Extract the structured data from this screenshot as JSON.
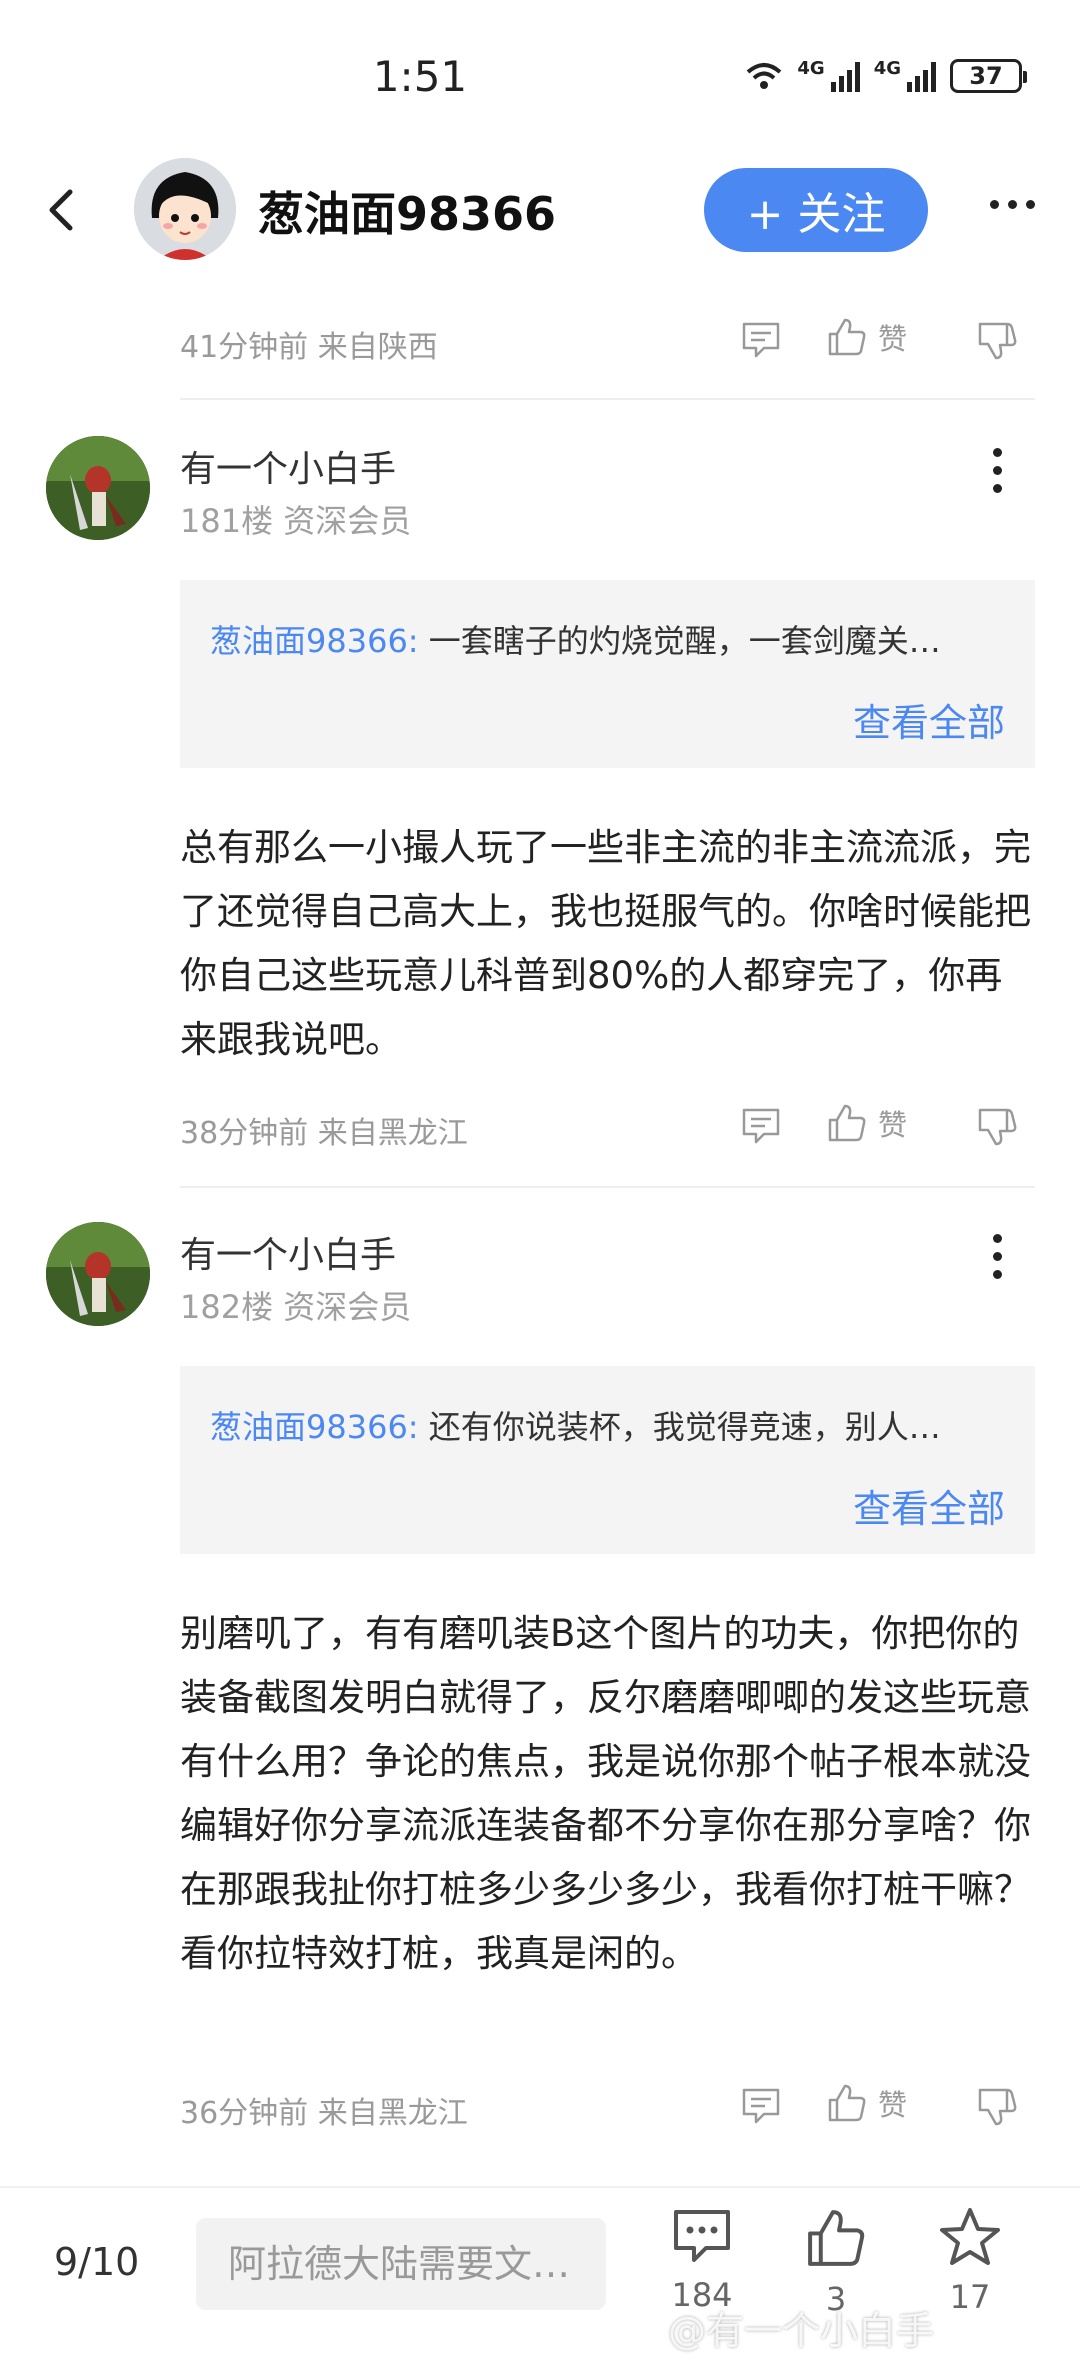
{
  "status_bar": {
    "time": "1:51",
    "network_label_1": "4G",
    "network_label_2": "4G",
    "battery": "37"
  },
  "header": {
    "username": "葱油面98366",
    "follow_label": "+ 关注"
  },
  "top_meta": {
    "time_location": "41分钟前 来自陕西",
    "like_label": "赞"
  },
  "comments": [
    {
      "author": "有一个小白手",
      "floor": "181楼 资深会员",
      "quote_user": "葱油面98366:",
      "quote_text": " 一套瞎子的灼烧觉醒，一套剑魔关…",
      "see_all": "查看全部",
      "body": "总有那么一小撮人玩了一些非主流的非主流流派，完了还觉得自己高大上，我也挺服气的。你啥时候能把你自己这些玩意儿科普到80%的人都穿完了，你再来跟我说吧。",
      "time_location": "38分钟前 来自黑龙江",
      "like_label": "赞"
    },
    {
      "author": "有一个小白手",
      "floor": "182楼 资深会员",
      "quote_user": "葱油面98366:",
      "quote_text": " 还有你说装杯，我觉得竞速，别人…",
      "see_all": "查看全部",
      "body": "别磨叽了，有有磨叽装B这个图片的功夫，你把你的装备截图发明白就得了，反尔磨磨唧唧的发这些玩意有什么用？争论的焦点，我是说你那个帖子根本就没编辑好你分享流派连装备都不分享你在那分享啥？你在那跟我扯你打桩多少多少多少，我看你打桩干嘛？看你拉特效打桩，我真是闲的。",
      "time_location": "36分钟前 来自黑龙江",
      "like_label": "赞"
    }
  ],
  "bottom_bar": {
    "page_indicator": "9/10",
    "reply_placeholder": "阿拉德大陆需要文…",
    "comment_count": "184",
    "like_count": "3",
    "favorite_count": "17",
    "watermark": "@有一个小白手"
  },
  "colors": {
    "accent": "#4b88f2",
    "meta_text": "#9a9a9a",
    "quote_bg": "#f4f4f5"
  }
}
